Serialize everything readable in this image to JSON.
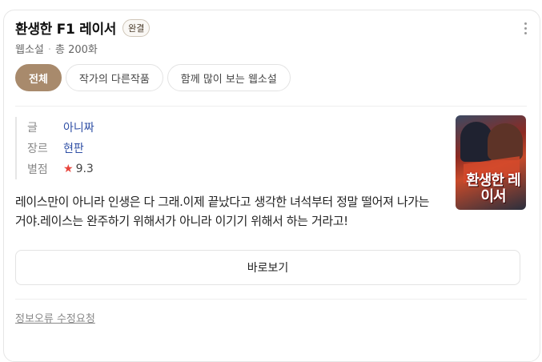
{
  "title": "환생한 F1 레이서",
  "badge": "완결",
  "subtitle": {
    "platform": "웹소설",
    "separator": "·",
    "episodes": "총 200화"
  },
  "tabs": [
    {
      "label": "전체",
      "active": true
    },
    {
      "label": "작가의 다른작품",
      "active": false
    },
    {
      "label": "함께 많이 보는 웹소설",
      "active": false
    }
  ],
  "info": {
    "author_key": "글",
    "author_value": "아니짜",
    "genre_key": "장르",
    "genre_value": "현판",
    "rating_key": "별점",
    "rating_star": "★",
    "rating_value": "9.3"
  },
  "cover": {
    "title_text": "환생한 레이서"
  },
  "description": "레이스만이 아니라 인생은 다 그래.이제 끝났다고 생각한 녀석부터 정말 떨어져 나가는 거야.레이스는 완주하기 위해서가 아니라 이기기 위해서 하는 거라고!",
  "view_button": "바로보기",
  "report_link": "정보오류 수정요청",
  "colors": {
    "accent": "#a88a6c",
    "link": "#2f4fa5",
    "star": "#e8453c"
  },
  "icons": {
    "more": "more-vertical-icon"
  }
}
